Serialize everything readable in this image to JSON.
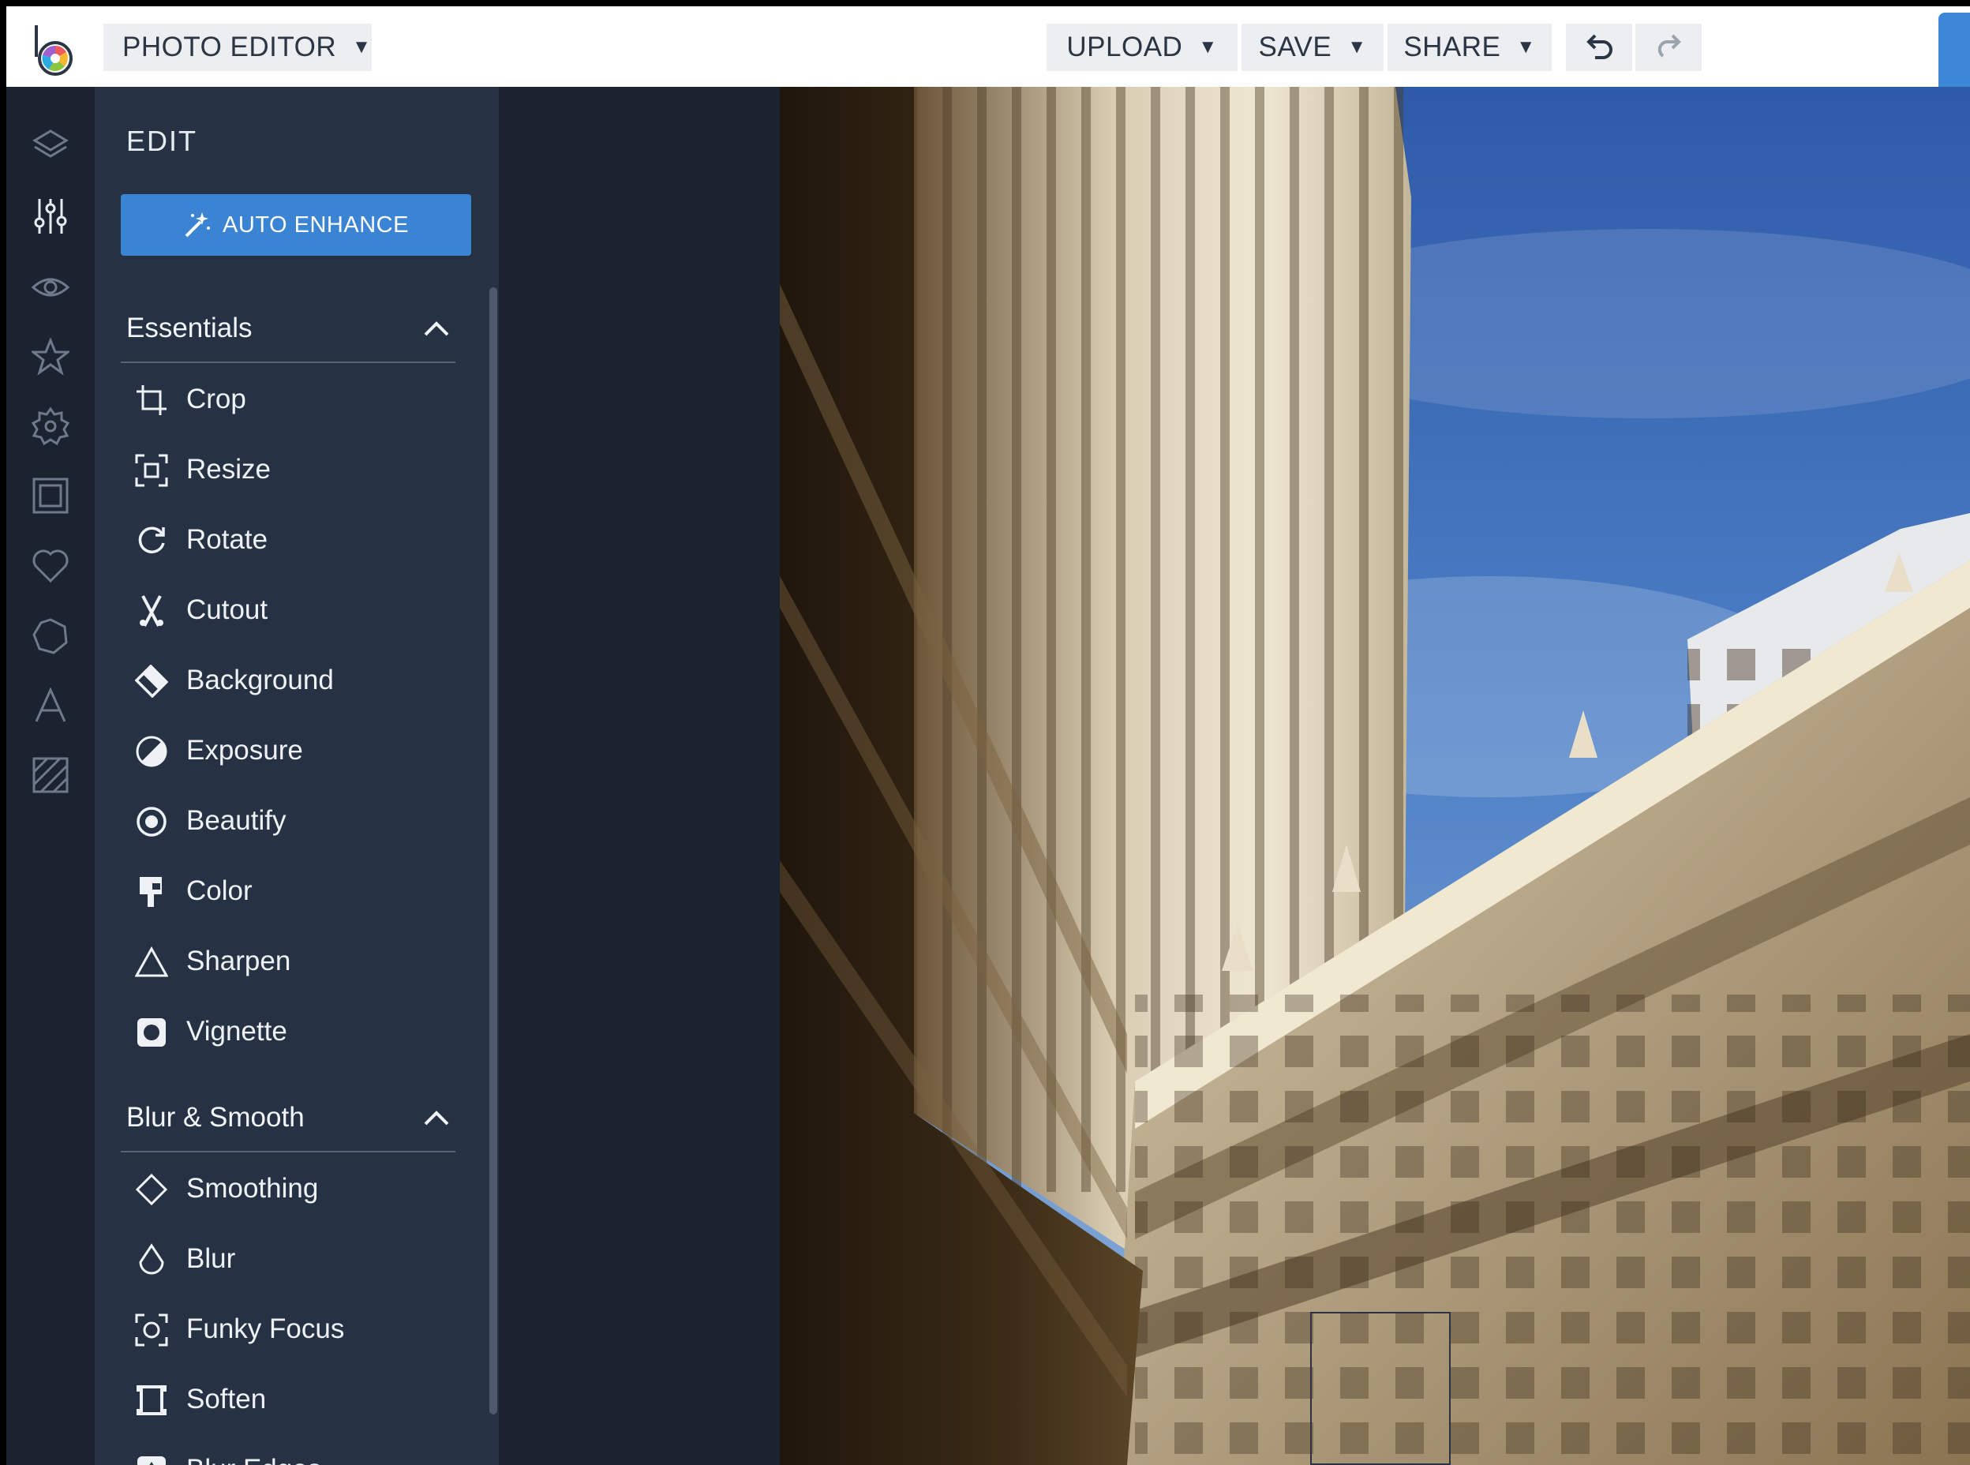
{
  "topbar": {
    "editor_menu_label": "PHOTO EDITOR",
    "upload_label": "UPLOAD",
    "save_label": "SAVE",
    "share_label": "SHARE",
    "caret": "▼"
  },
  "icons": {
    "logo": "befunky-logo-icon",
    "undo": "undo-icon",
    "redo": "redo-icon",
    "rail": [
      "layers-icon",
      "sliders-icon",
      "eye-icon",
      "star-icon",
      "badge-icon",
      "frame-icon",
      "heart-icon",
      "shape-icon",
      "text-icon",
      "texture-icon"
    ]
  },
  "panel": {
    "title": "EDIT",
    "auto_enhance_label": "AUTO ENHANCE",
    "essentials": {
      "heading": "Essentials",
      "items": [
        "Crop",
        "Resize",
        "Rotate",
        "Cutout",
        "Background",
        "Exposure",
        "Beautify",
        "Color",
        "Sharpen",
        "Vignette"
      ]
    },
    "blur_smooth": {
      "heading": "Blur & Smooth",
      "items": [
        "Smoothing",
        "Blur",
        "Funky Focus",
        "Soften",
        "Blur Edges"
      ]
    }
  },
  "colors": {
    "accent": "#3b84d4",
    "panel_bg": "#263243",
    "rail_bg": "#1b2330",
    "topbar_bg": "#ffffff"
  },
  "canvas": {
    "image": "city-buildings-photo"
  }
}
